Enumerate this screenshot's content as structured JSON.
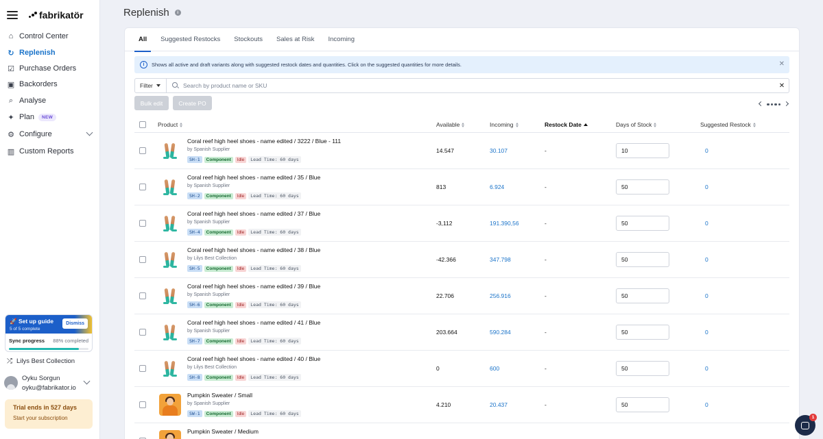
{
  "brand": {
    "name": "fabrikatör"
  },
  "sidebar": {
    "items": [
      {
        "label": "Control Center",
        "icon": "home-icon"
      },
      {
        "label": "Replenish",
        "icon": "refresh-icon",
        "active": true
      },
      {
        "label": "Purchase Orders",
        "icon": "checkbox-icon"
      },
      {
        "label": "Backorders",
        "icon": "box-icon"
      },
      {
        "label": "Analyse",
        "icon": "search-icon"
      },
      {
        "label": "Plan",
        "icon": "sparkle-icon",
        "badge": "NEW"
      },
      {
        "label": "Configure",
        "icon": "sliders-icon",
        "expandable": true
      },
      {
        "label": "Custom Reports",
        "icon": "bar-chart-icon"
      }
    ],
    "guide": {
      "title": "Set up guide",
      "subtitle": "5 of 5 complete",
      "dismiss_label": "Dismiss",
      "sync_label": "Sync progress",
      "sync_value": "88% completed",
      "sync_fraction": 0.88
    },
    "store": "Lilys Best Collection",
    "user": {
      "name": "Oyku Sorgun",
      "email": "oyku@fabrikator.io"
    },
    "trial": {
      "title": "Trial ends in 527 days",
      "cta": "Start your subscription"
    }
  },
  "page": {
    "title": "Replenish"
  },
  "tabs": [
    "All",
    "Suggested Restocks",
    "Stockouts",
    "Sales at Risk",
    "Incoming"
  ],
  "banner": {
    "text": "Shows all active and draft variants along with suggested restock dates and quantities. Click on the suggested quantities for more details."
  },
  "filter": {
    "label": "Filter",
    "search_placeholder": "Search by product name or SKU"
  },
  "actions": {
    "bulk_edit": "Bulk edit",
    "create_po": "Create PO"
  },
  "table": {
    "headers": {
      "product": "Product",
      "available": "Available",
      "incoming": "Incoming",
      "restock_date": "Restock Date",
      "days_of_stock": "Days of Stock",
      "suggested_restock": "Suggested Restock"
    },
    "rows": [
      {
        "name": "Coral reef high heel shoes - name edited / 3222 / Blue - 111",
        "supplier": "by Spanish Supplier",
        "sku": "SH-1",
        "type": "Component",
        "status": "Idle",
        "lead": "Lead Time: 60 days",
        "available": "14.547",
        "incoming": "30.107",
        "restock": "-",
        "dos": "10",
        "suggested": "0",
        "thumb": "shoe"
      },
      {
        "name": "Coral reef high heel shoes - name edited / 35 / Blue",
        "supplier": "by Spanish Supplier",
        "sku": "SH-2",
        "type": "Component",
        "status": "Idle",
        "lead": "Lead Time: 60 days",
        "available": "813",
        "incoming": "6.924",
        "restock": "-",
        "dos": "50",
        "suggested": "0",
        "thumb": "shoe"
      },
      {
        "name": "Coral reef high heel shoes - name edited / 37 / Blue",
        "supplier": "by Spanish Supplier",
        "sku": "SH-4",
        "type": "Component",
        "status": "Idle",
        "lead": "Lead Time: 60 days",
        "available": "-3,112",
        "incoming": "191.390,56",
        "restock": "-",
        "dos": "50",
        "suggested": "0",
        "thumb": "shoe"
      },
      {
        "name": "Coral reef high heel shoes - name edited / 38 / Blue",
        "supplier": "by Lilys Best Collection",
        "sku": "SH-5",
        "type": "Component",
        "status": "Idle",
        "lead": "Lead Time: 60 days",
        "available": "-42.366",
        "incoming": "347.798",
        "restock": "-",
        "dos": "50",
        "suggested": "0",
        "thumb": "shoe"
      },
      {
        "name": "Coral reef high heel shoes - name edited / 39 / Blue",
        "supplier": "by Spanish Supplier",
        "sku": "SH-6",
        "type": "Component",
        "status": "Idle",
        "lead": "Lead Time: 60 days",
        "available": "22.706",
        "incoming": "256.916",
        "restock": "-",
        "dos": "50",
        "suggested": "0",
        "thumb": "shoe"
      },
      {
        "name": "Coral reef high heel shoes - name edited / 41 / Blue",
        "supplier": "by Spanish Supplier",
        "sku": "SH-7",
        "type": "Component",
        "status": "Idle",
        "lead": "Lead Time: 60 days",
        "available": "203.664",
        "incoming": "590.284",
        "restock": "-",
        "dos": "50",
        "suggested": "0",
        "thumb": "shoe"
      },
      {
        "name": "Coral reef high heel shoes - name edited / 40 / Blue",
        "supplier": "by Lilys Best Collection",
        "sku": "SH-8",
        "type": "Component",
        "status": "Idle",
        "lead": "Lead Time: 60 days",
        "available": "0",
        "incoming": "600",
        "restock": "-",
        "dos": "50",
        "suggested": "0",
        "thumb": "shoe"
      },
      {
        "name": "Pumpkin Sweater / Small",
        "supplier": "by Spanish Supplier",
        "sku": "SW-1",
        "type": "Component",
        "status": "Idle",
        "lead": "Lead Time: 60 days",
        "available": "4.210",
        "incoming": "20.437",
        "restock": "-",
        "dos": "50",
        "suggested": "0",
        "thumb": "sweater"
      },
      {
        "name": "Pumpkin Sweater / Medium",
        "supplier": "",
        "sku": "",
        "type": "",
        "status": "",
        "lead": "",
        "available": "",
        "incoming": "",
        "restock": "",
        "dos": "",
        "suggested": "",
        "thumb": "sweater"
      }
    ]
  },
  "chat": {
    "badge": "1"
  },
  "colors": {
    "accent": "#1c5fc9",
    "link": "#1a73c9",
    "sidebar_bg": "#ffffff",
    "page_bg": "#eef0f6"
  }
}
